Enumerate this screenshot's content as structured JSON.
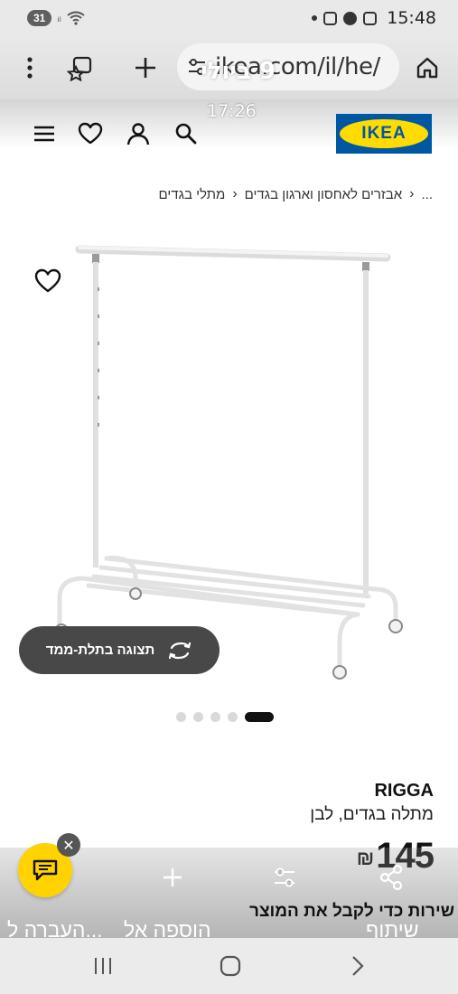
{
  "status_bar": {
    "badge": "31",
    "time": "15:48"
  },
  "browser": {
    "url": "ikea.com/il/he/",
    "date_overlay": "9 ביולי",
    "time_overlay": "17:26"
  },
  "header": {
    "logo_text": "IKEA",
    "colors": {
      "logo_blue": "#0058a3",
      "logo_yellow": "#ffdb00"
    }
  },
  "breadcrumb": {
    "items": [
      "...",
      "אבזרים לאחסון וארגון בגדים",
      "מתלי בגדים"
    ]
  },
  "product": {
    "name": "RIGGA",
    "description": "מתלה בגדים, לבן",
    "price": "145",
    "currency": "₪",
    "view_3d_label": "תצוגה בתלת-ממד",
    "carousel": {
      "count": 5,
      "active": 5
    }
  },
  "actions": {
    "share_label": "שיתוף",
    "add_label": "הוספה אל",
    "move_label": "העברה ל...",
    "behind_text": "שירות כדי לקבל את המוצר"
  }
}
